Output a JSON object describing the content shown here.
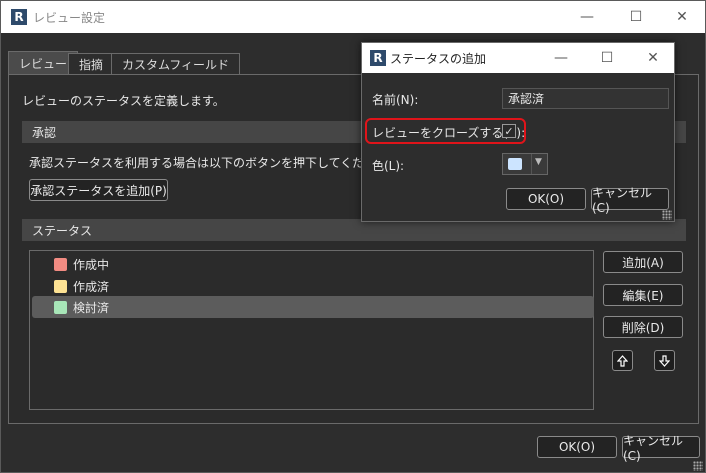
{
  "window": {
    "title": "レビュー設定",
    "app_icon_letter": "R",
    "minimize_glyph": "—",
    "maximize_glyph": "☐",
    "close_glyph": "✕"
  },
  "tabs": [
    {
      "label": "レビュー",
      "active": true
    },
    {
      "label": "指摘",
      "active": false
    },
    {
      "label": "カスタムフィールド",
      "active": false
    }
  ],
  "review_tab": {
    "description": "レビューのステータスを定義します。",
    "approval_section": {
      "header": "承認",
      "description": "承認ステータスを利用する場合は以下のボタンを押下してください。",
      "add_button": "承認ステータスを追加(P)"
    },
    "status_section": {
      "header": "ステータス",
      "items": [
        {
          "label": "作成中",
          "color": "#f28b82",
          "selected": false
        },
        {
          "label": "作成済",
          "color": "#fde293",
          "selected": false
        },
        {
          "label": "検討済",
          "color": "#a8e6b8",
          "selected": true
        }
      ],
      "add_button": "追加(A)",
      "edit_button": "編集(E)",
      "delete_button": "削除(D)",
      "move_up_icon": "up-arrow-icon",
      "move_down_icon": "down-arrow-icon"
    }
  },
  "footer": {
    "ok_button": "OK(O)",
    "cancel_button": "キャンセル(C)"
  },
  "dialog": {
    "title": "ステータスの追加",
    "app_icon_letter": "R",
    "name_label": "名前(N):",
    "name_value": "承認済",
    "close_status_label": "レビューをクローズする(R):",
    "close_status_checked": true,
    "color_label": "色(L):",
    "color_value": "#cce4ff",
    "ok_button": "OK(O)",
    "cancel_button": "キャンセル(C)"
  },
  "colors": {
    "background": "#2b2b2b",
    "highlight": "#e0141a"
  }
}
